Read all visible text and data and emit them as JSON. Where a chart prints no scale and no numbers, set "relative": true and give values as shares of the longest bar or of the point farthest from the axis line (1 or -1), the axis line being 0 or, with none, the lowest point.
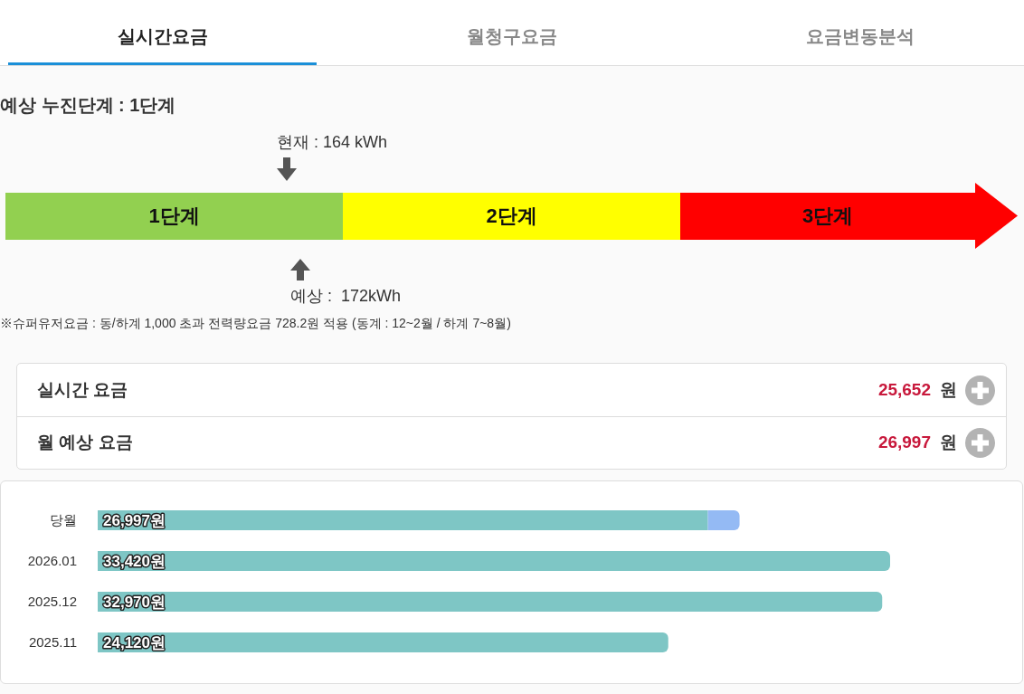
{
  "tabs": [
    {
      "label": "실시간요금",
      "selected": true
    },
    {
      "label": "월청구요금",
      "selected": false
    },
    {
      "label": "요금변동분석",
      "selected": false
    }
  ],
  "progressive_tier": {
    "heading": "예상 누진단계 : 1단계",
    "current_marker": "현재 : 164 kWh",
    "stages": [
      {
        "label": "1단계",
        "color": "#92d050"
      },
      {
        "label": "2단계",
        "color": "#ffff00"
      },
      {
        "label": "3단계",
        "color": "#ff0000"
      }
    ],
    "forecast_marker": "예상 :  172kWh",
    "note": "※슈퍼유저요금 : 동/하계 1,000 초과 전력량요금 728.2원 적용 (동계 : 12~2월 / 하계 7~8월)"
  },
  "charges": [
    {
      "label": "실시간 요금",
      "amount": "25,652",
      "unit": "원"
    },
    {
      "label": "월 예상 요금",
      "amount": "26,997",
      "unit": "원"
    }
  ],
  "comparison": {
    "chart_data": {
      "type": "bar",
      "orientation": "horizontal",
      "stacked": true,
      "relative": true,
      "categories": [
        "당월",
        "2026.01",
        "2025.12",
        "2025.11"
      ],
      "series": [
        {
          "color": "#7ec6c5",
          "values": [
            0.77,
            1.0,
            0.99,
            0.72
          ]
        },
        {
          "color": "#94baf4",
          "values": [
            0.04,
            0,
            0,
            0
          ]
        }
      ],
      "value_labels": [
        "26,997원",
        "33,420원",
        "32,970원",
        "24,120원"
      ]
    }
  }
}
